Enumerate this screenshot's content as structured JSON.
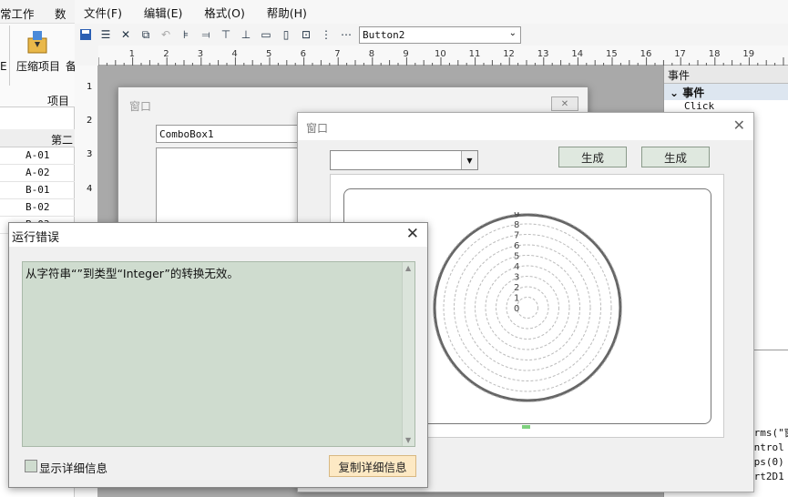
{
  "bg_app": {
    "menu1": "常工作",
    "menu2": "数据",
    "tool_partial": "E",
    "compress_label": "压缩项目",
    "backup_partial": "备",
    "group_label": "项目",
    "col_header": "第二",
    "rows": [
      "A-01",
      "A-02",
      "B-01",
      "B-02",
      "B-03"
    ]
  },
  "ide": {
    "menus": [
      "文件(F)",
      "编辑(E)",
      "格式(O)",
      "帮助(H)"
    ],
    "control_selector": "Button2",
    "ruler_numbers": [
      "1",
      "2",
      "3",
      "4",
      "5",
      "6",
      "7",
      "8",
      "9",
      "10",
      "11",
      "12",
      "13",
      "14",
      "15",
      "16",
      "17",
      "18",
      "19"
    ],
    "vruler_numbers": [
      "1",
      "2",
      "3",
      "4"
    ],
    "props_header": "事件",
    "props_group": "事件",
    "props_item": "Click",
    "code_lines": [
      "orms(\"窗",
      "ontrol",
      "ups(0)",
      "art2D1"
    ]
  },
  "design_window": {
    "title": "窗口",
    "combo_value": "ComboBox1"
  },
  "runtime_window": {
    "title": "窗口",
    "combo_value": "",
    "buttons": [
      "生成",
      "生成"
    ],
    "radar_labels": [
      "9",
      "8",
      "7",
      "6",
      "5",
      "4",
      "3",
      "2",
      "1",
      "0"
    ]
  },
  "error_dialog": {
    "title": "运行错误",
    "message": "从字符串“”到类型“Integer”的转换无效。",
    "checkbox_label": "显示详细信息",
    "copy_button": "复制详细信息"
  },
  "colors": {
    "accent_green": "#cfdccf",
    "button_green": "#dce7dc",
    "copy_button": "#fde9c4"
  }
}
